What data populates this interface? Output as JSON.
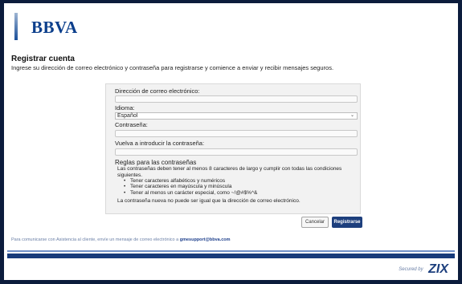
{
  "brand": {
    "name": "BBVA",
    "color": "#0c3f8c"
  },
  "header": {
    "title": "Registrar cuenta",
    "subtitle": "Ingrese su dirección de correo electrónico y contraseña para registrarse y comience a enviar y recibir mensajes seguros."
  },
  "form": {
    "email_label": "Dirección de correo electrónico:",
    "email_value": "",
    "language_label": "Idioma:",
    "language_selected": "Español",
    "password_label": "Contraseña:",
    "password_value": "",
    "confirm_label": "Vuelva a introducir la contraseña:",
    "confirm_value": "",
    "rules_title": "Reglas para las contraseñas",
    "rules_intro": "Las contraseñas deben tener al menos 8 caracteres de largo y cumplir con todas las condiciones siguientes.",
    "rules": [
      "Tener caracteres alfabéticos y numéricos",
      "Tener caracteres en mayúscula y minúscula",
      "Tener al menos un carácter especial, como ~!@#$%^&"
    ],
    "rules_note": "La contraseña nueva no puede ser igual que la dirección de correo electrónico.",
    "cancel_label": "Cancelar",
    "register_label": "Registrarse"
  },
  "footer": {
    "text": "Para comunicarse con Asistencia al cliente, envíe un mensaje de correo electrónico a",
    "email": "gmesupport@bbva.com",
    "secured_by": "Secured by",
    "secured_brand": "ZIX"
  },
  "colors": {
    "frame": "#0c1c3c",
    "accent_band": "#173a7a",
    "button_primary": "#1d3f7d"
  }
}
